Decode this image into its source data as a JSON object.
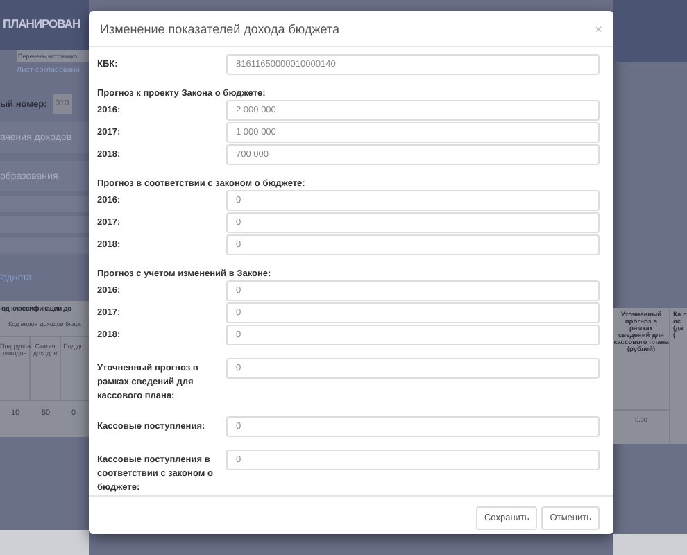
{
  "page": {
    "header_title": "ПЛАНИРОВАН",
    "tab": "Перечень источнико",
    "link": "Лист согласовани",
    "number_label": "ый номер:",
    "number_value": "010",
    "sections": [
      "ачения доходов",
      "образования"
    ],
    "budget_link": "юджета",
    "table": {
      "title": "од классификации до",
      "subheader": "Код видов доходов бюдж",
      "columns": [
        "Подгруппа доходов",
        "Статья доходов",
        "Под до"
      ],
      "row": [
        "10",
        "50",
        "0"
      ],
      "right_columns": [
        "Уточненный прогноз в рамках сведений для кассового плана (рублей)",
        "Ка пос (да ("
      ],
      "right_row": [
        "0.00"
      ]
    }
  },
  "modal": {
    "title": "Изменение показателей дохода бюджета",
    "close": "×",
    "rows": [
      {
        "kind": "field",
        "label": "КБК:",
        "value": "81611650000010000140"
      },
      {
        "kind": "heading",
        "label": "Прогноз к проекту Закона о бюджете:"
      },
      {
        "kind": "field",
        "label": "2016:",
        "value": "2 000 000"
      },
      {
        "kind": "field",
        "label": "2017:",
        "value": "1 000 000"
      },
      {
        "kind": "field",
        "label": "2018:",
        "value": "700 000"
      },
      {
        "kind": "heading",
        "label": "Прогноз в соответствии с законом о бюджете:"
      },
      {
        "kind": "field",
        "label": "2016:",
        "value": "0"
      },
      {
        "kind": "field",
        "label": "2017:",
        "value": "0"
      },
      {
        "kind": "field",
        "label": "2018:",
        "value": "0"
      },
      {
        "kind": "heading",
        "label": "Прогноз с учетом изменений в Законе:"
      },
      {
        "kind": "field",
        "label": "2016:",
        "value": "0"
      },
      {
        "kind": "field",
        "label": "2017:",
        "value": "0"
      },
      {
        "kind": "field",
        "label": "2018:",
        "value": "0"
      },
      {
        "kind": "field",
        "label": "Уточненный прогноз в рамках сведений для кассового плана:",
        "value": "0"
      },
      {
        "kind": "field",
        "label": "Кассовые поступления:",
        "value": "0"
      },
      {
        "kind": "field",
        "label": "Кассовые поступления в соответствии с законом о бюджете:",
        "value": "0"
      }
    ],
    "buttons": [
      "Сохранить",
      "Отменить"
    ]
  }
}
